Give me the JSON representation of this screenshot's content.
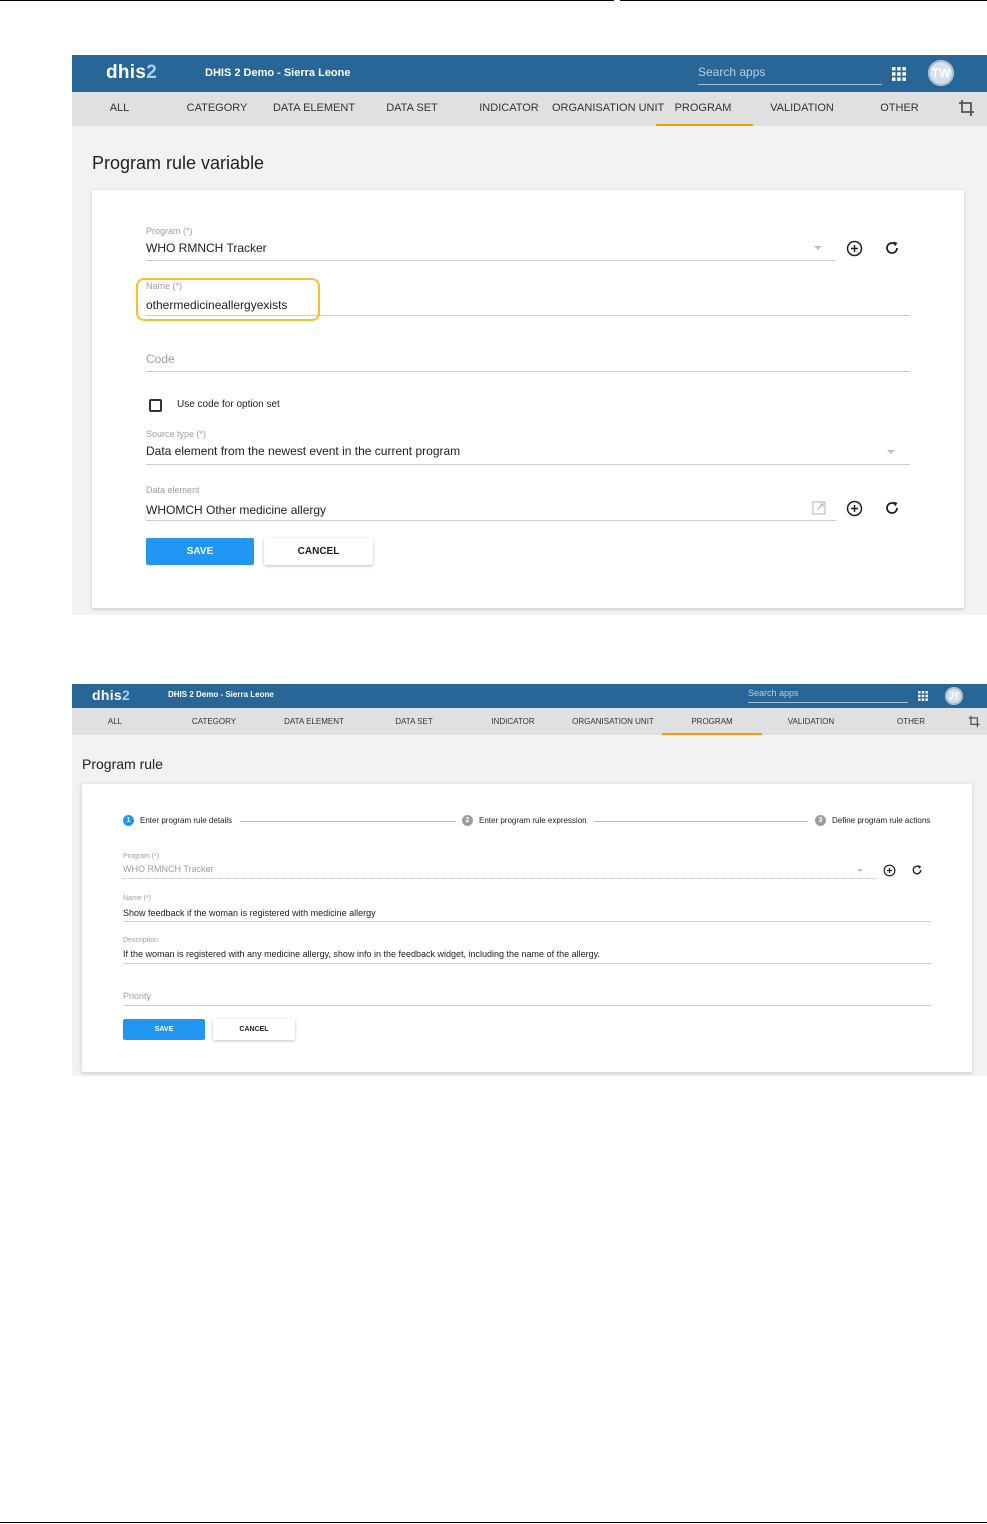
{
  "screen1": {
    "header": {
      "logo_main": "dhis",
      "logo_num": "2",
      "app_title": "DHIS 2 Demo - Sierra Leone",
      "search_placeholder": "Search apps",
      "apps_icon": "apps-grid-icon",
      "avatar_initials": "TW"
    },
    "tabs": [
      "ALL",
      "CATEGORY",
      "DATA ELEMENT",
      "DATA SET",
      "INDICATOR",
      "ORGANISATION UNIT",
      "PROGRAM",
      "VALIDATION",
      "OTHER"
    ],
    "active_tab": "PROGRAM",
    "page_title": "Program rule variable",
    "form": {
      "program_label": "Program (*)",
      "program_value": "WHO RMNCH Tracker",
      "name_label": "Name (*)",
      "name_value": "othermedicineallergyexists",
      "code_placeholder": "Code",
      "use_code_label": "Use code for option set",
      "use_code_checked": false,
      "source_type_label": "Source type (*)",
      "source_type_value": "Data element from the newest event in the current program",
      "data_element_label": "Data element",
      "data_element_value": "WHOMCH Other medicine allergy",
      "save_label": "SAVE",
      "cancel_label": "CANCEL"
    }
  },
  "screen2": {
    "header": {
      "logo_main": "dhis",
      "logo_num": "2",
      "app_title": "DHIS 2 Demo - Sierra Leone",
      "search_placeholder": "Search apps",
      "avatar_initials": "JT"
    },
    "tabs": [
      "ALL",
      "CATEGORY",
      "DATA ELEMENT",
      "DATA SET",
      "INDICATOR",
      "ORGANISATION UNIT",
      "PROGRAM",
      "VALIDATION",
      "OTHER"
    ],
    "active_tab": "PROGRAM",
    "page_title": "Program rule",
    "steps": [
      {
        "num": "1",
        "label": "Enter program rule details",
        "active": true
      },
      {
        "num": "2",
        "label": "Enter program rule expression",
        "active": false
      },
      {
        "num": "3",
        "label": "Define program rule actions",
        "active": false
      }
    ],
    "form": {
      "program_label": "Program (*)",
      "program_value": "WHO RMNCH Tracker",
      "name_label": "Name (*)",
      "name_value": "Show feedback if the woman is registered with medicine allergy",
      "description_label": "Description",
      "description_value": "If the woman is registered with any medicine allergy, show info in the feedback widget, including the name of the allergy.",
      "priority_placeholder": "Priority",
      "save_label": "SAVE",
      "cancel_label": "CANCEL"
    }
  },
  "colors": {
    "header_bg": "#276696",
    "nav_bg": "#e0e0e0",
    "active_tab_underline": "#ff9800",
    "primary_button": "#2196f3",
    "highlight_outline": "#f4c032",
    "page_bg": "#f2f2f2"
  }
}
